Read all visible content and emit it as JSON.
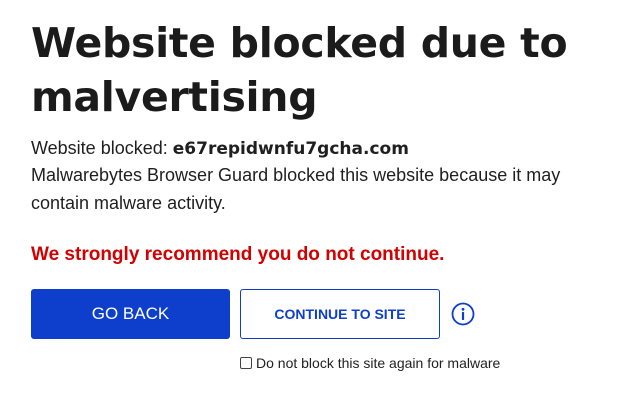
{
  "page": {
    "title": "Website blocked due to malvertising",
    "blocked_label": "Website blocked:",
    "blocked_domain": "e67repidwnfu7gcha.com",
    "description": "Malwarebytes Browser Guard blocked this website because it may contain malware activity.",
    "warning": "We strongly recommend you do not continue."
  },
  "actions": {
    "go_back_label": "GO BACK",
    "continue_label": "CONTINUE TO SITE",
    "info_icon": "info-circle-icon",
    "checkbox_label": "Do not block this site again for malware",
    "checkbox_checked": false
  },
  "colors": {
    "primary": "#0d3ecc",
    "warning": "#d20000",
    "text": "#1f1f1f"
  }
}
